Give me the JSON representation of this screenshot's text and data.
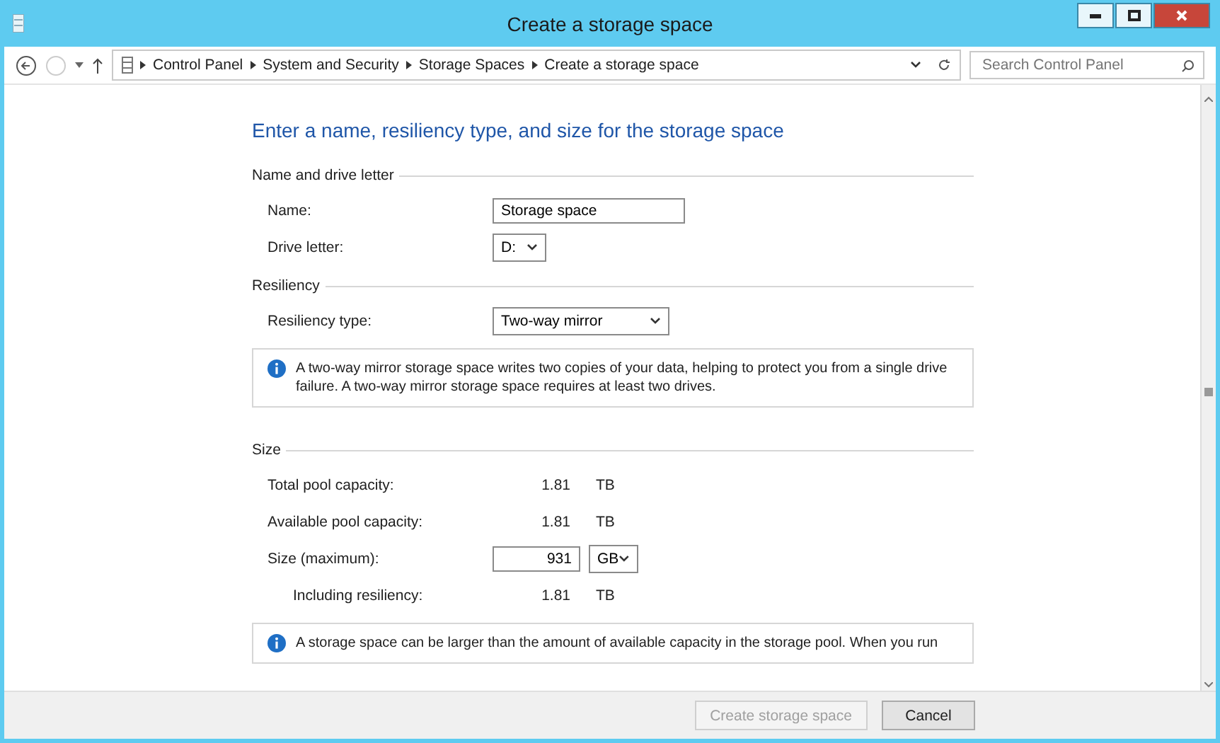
{
  "window": {
    "title": "Create a storage space"
  },
  "address_bar": {
    "breadcrumb": [
      "Control Panel",
      "System and Security",
      "Storage Spaces",
      "Create a storage space"
    ],
    "search": {
      "placeholder": "Search Control Panel"
    }
  },
  "heading": "Enter a name, resiliency type, and size for the storage space",
  "sections": [
    {
      "title": "Name and drive letter",
      "rows": [
        {
          "kind": "text-field",
          "label": "Name:",
          "value": "Storage space"
        },
        {
          "kind": "dropdown",
          "label": "Drive letter:",
          "value": "D:"
        }
      ]
    },
    {
      "title": "Resiliency",
      "rows": [
        {
          "kind": "wide-dropdown",
          "label": "Resiliency type:",
          "value": "Two-way mirror"
        }
      ],
      "info": "A two-way mirror storage space writes two copies of your data, helping to protect you from a single drive failure. A two-way mirror storage space requires at least two drives."
    },
    {
      "title": "Size",
      "rows": [
        {
          "kind": "value",
          "label": "Total pool capacity:",
          "value": "1.81",
          "unit": "TB"
        },
        {
          "kind": "value",
          "label": "Available pool capacity:",
          "value": "1.81",
          "unit": "TB"
        },
        {
          "kind": "size-field",
          "label": "Size (maximum):",
          "value": "931",
          "unit": "GB"
        },
        {
          "kind": "sub-value",
          "label": "Including resiliency:",
          "value": "1.81",
          "unit": "TB"
        }
      ],
      "info": "A storage space can be larger than the amount of available capacity in the storage pool. When you run"
    }
  ],
  "buttons": [
    {
      "label": "Create storage space",
      "disabled": true
    },
    {
      "label": "Cancel",
      "disabled": false
    }
  ]
}
